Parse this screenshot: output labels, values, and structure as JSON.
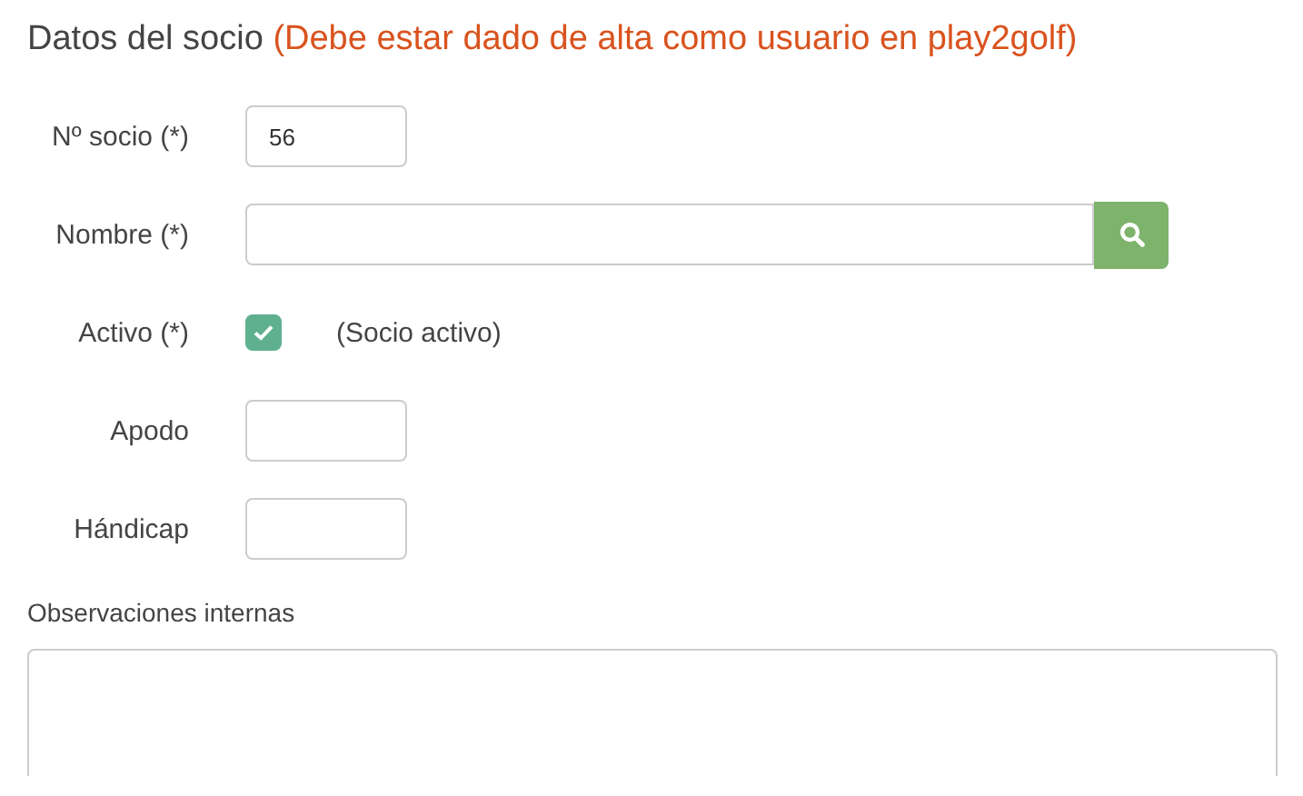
{
  "section": {
    "title": "Datos del socio",
    "note": "(Debe estar dado de alta como usuario en play2golf)"
  },
  "fields": [
    {
      "kind": "short",
      "label": "Nº socio (*)",
      "value": "56"
    },
    {
      "kind": "search",
      "label": "Nombre (*)"
    },
    {
      "kind": "checkbox",
      "label": "Activo (*)",
      "checked": true,
      "caption": "(Socio activo)"
    },
    {
      "kind": "short",
      "label": "Apodo"
    },
    {
      "kind": "short",
      "label": "Hándicap"
    }
  ],
  "notes": {
    "label": "Observaciones internas"
  }
}
